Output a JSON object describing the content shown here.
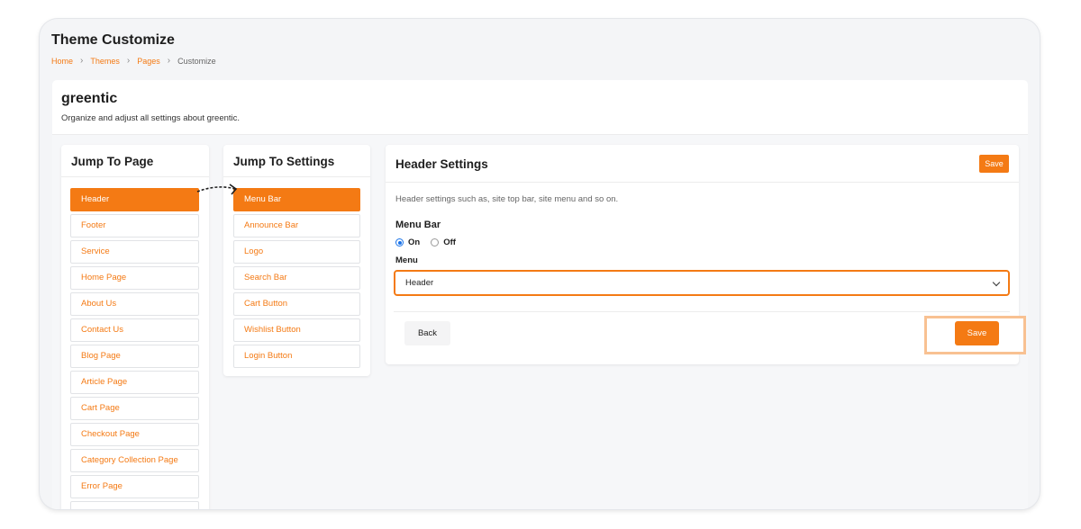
{
  "page": {
    "title": "Theme Customize",
    "breadcrumb": [
      "Home",
      "Themes",
      "Pages",
      "Customize"
    ]
  },
  "store": {
    "name": "greentic",
    "description": "Organize and adjust all settings about greentic."
  },
  "jump_to_page": {
    "title": "Jump To Page",
    "items": [
      {
        "label": "Header",
        "active": true
      },
      {
        "label": "Footer",
        "active": false
      },
      {
        "label": "Service",
        "active": false
      },
      {
        "label": "Home Page",
        "active": false
      },
      {
        "label": "About Us",
        "active": false
      },
      {
        "label": "Contact Us",
        "active": false
      },
      {
        "label": "Blog Page",
        "active": false
      },
      {
        "label": "Article Page",
        "active": false
      },
      {
        "label": "Cart Page",
        "active": false
      },
      {
        "label": "Checkout Page",
        "active": false
      },
      {
        "label": "Category Collection Page",
        "active": false
      },
      {
        "label": "Error Page",
        "active": false
      },
      {
        "label": "",
        "active": false
      }
    ]
  },
  "jump_to_settings": {
    "title": "Jump To Settings",
    "items": [
      {
        "label": "Menu Bar",
        "active": true
      },
      {
        "label": "Announce Bar",
        "active": false
      },
      {
        "label": "Logo",
        "active": false
      },
      {
        "label": "Search Bar",
        "active": false
      },
      {
        "label": "Cart Button",
        "active": false
      },
      {
        "label": "Wishlist Button",
        "active": false
      },
      {
        "label": "Login Button",
        "active": false
      }
    ]
  },
  "header_settings": {
    "title": "Header Settings",
    "save_small_label": "Save",
    "description": "Header settings such as, site top bar, site menu and so on.",
    "menu_bar_label": "Menu Bar",
    "radio": {
      "on_label": "On",
      "off_label": "Off",
      "selected": "On"
    },
    "menu_label": "Menu",
    "menu_value": "Header",
    "back_label": "Back",
    "save_label": "Save"
  },
  "colors": {
    "accent": "#f47a14",
    "highlight": "#f8c192",
    "radio_selected": "#1a73e8"
  },
  "icons": {
    "breadcrumb_separator": "chevron-right-icon",
    "select": "chevron-down-icon",
    "annotation": "dashed-arrow-icon"
  }
}
